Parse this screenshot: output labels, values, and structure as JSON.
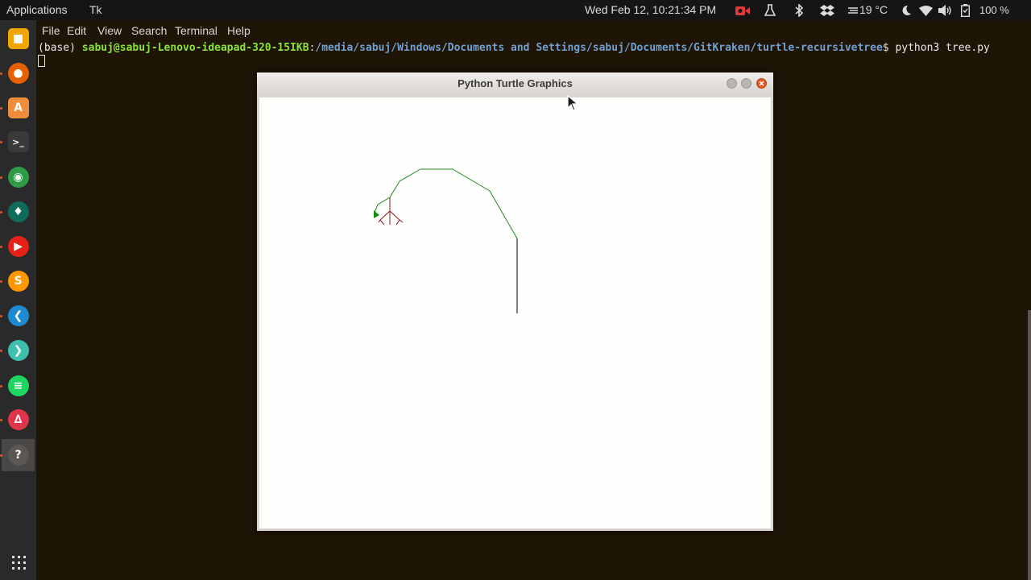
{
  "topbar": {
    "applications": "Applications",
    "app_name": "Tk",
    "datetime": "Wed Feb 12, 10:21:34 PM",
    "temperature": "19 °C",
    "battery": "100 %"
  },
  "launcher": {
    "items": [
      {
        "name": "files",
        "icon": "folder-icon",
        "color": "#f0a600"
      },
      {
        "name": "firefox",
        "icon": "firefox-icon",
        "color": "#e66000"
      },
      {
        "name": "software",
        "icon": "store-icon",
        "color": "#ef8d3c"
      },
      {
        "name": "terminal",
        "icon": "terminal-icon",
        "color": "#3a3a3a"
      },
      {
        "name": "chrome",
        "icon": "chrome-icon",
        "color": "#2f9b47"
      },
      {
        "name": "gitkraken",
        "icon": "gitkraken-icon",
        "color": "#0f6b5c"
      },
      {
        "name": "youtube",
        "icon": "youtube-icon",
        "color": "#e62117"
      },
      {
        "name": "sublime",
        "icon": "sublime-icon",
        "color": "#ff9800"
      },
      {
        "name": "vscode",
        "icon": "vscode-icon",
        "color": "#1f8ad2"
      },
      {
        "name": "remote",
        "icon": "remote-icon",
        "color": "#3fbfae"
      },
      {
        "name": "spotify",
        "icon": "spotify-icon",
        "color": "#1ed760"
      },
      {
        "name": "bootable",
        "icon": "flask-icon",
        "color": "#e0344a"
      },
      {
        "name": "python-tk",
        "icon": "python-icon",
        "color": "#5a5754"
      }
    ]
  },
  "terminal": {
    "menu": [
      "File",
      "Edit",
      "View",
      "Search",
      "Terminal",
      "Help"
    ],
    "prompt_prefix": "(base) ",
    "prompt_user": "sabuj@sabuj-Lenovo-ideapad-320-15IKB",
    "prompt_colon": ":",
    "prompt_path": "/media/sabuj/Windows/Documents and Settings/sabuj/Documents/GitKraken/turtle-recursivetree",
    "prompt_dollar": "$ ",
    "command": "python3 tree.py"
  },
  "turtle_window": {
    "title": "Python Turtle Graphics"
  },
  "colors": {
    "trunk": "#000000",
    "curve": "#1f8a1f",
    "branches": "#8b1a1a",
    "turtle": "#1a8a1a"
  }
}
